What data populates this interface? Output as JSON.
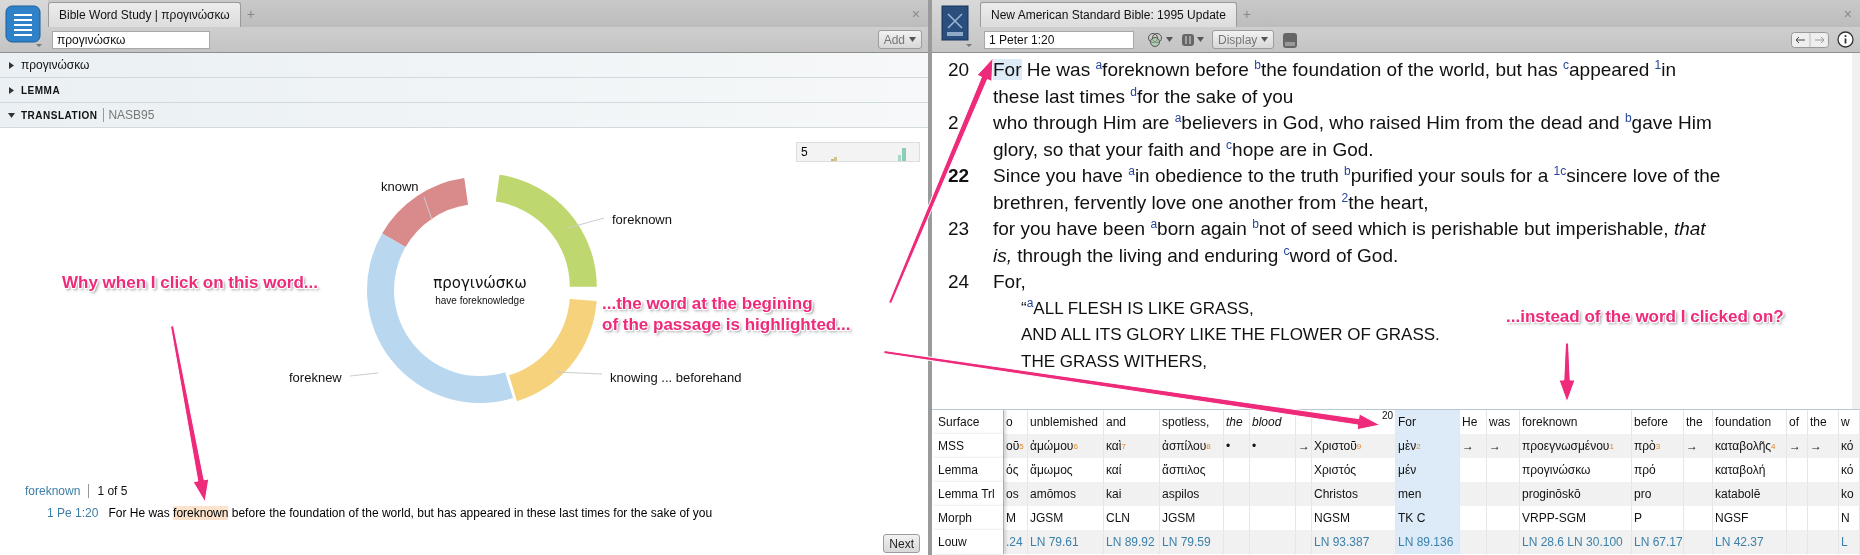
{
  "word_study": {
    "tab": {
      "title": "Bible Word Study | προγινώσκω",
      "selected": true
    },
    "new_tab": "+",
    "close": "×",
    "search": {
      "value": "προγινώσκω"
    },
    "add_button": "Add",
    "sections": [
      {
        "title": "προγινώσκω",
        "expanded": false
      },
      {
        "title": "LEMMA",
        "expanded": false
      },
      {
        "title": "TRANSLATION",
        "subtitle": "NASB95",
        "expanded": true
      }
    ],
    "mini_chart": {
      "label": "5"
    },
    "donut": {
      "center_title": "προγινώσκω",
      "center_subtitle": "have foreknowledge",
      "segments": [
        {
          "label": "known",
          "color": "#d98a8a"
        },
        {
          "label": "foreknown",
          "color": "#bed86f"
        },
        {
          "label": "foreknew",
          "color": "#b9d7ef"
        },
        {
          "label": "knowing ... beforehand",
          "color": "#f6d27c"
        }
      ]
    },
    "results": {
      "word": "foreknown",
      "count": "1 of 5",
      "items": [
        {
          "reference": "1 Pe 1:20",
          "segments": [
            {
              "text": "For He was ",
              "highlighted": false
            },
            {
              "text": "foreknown",
              "highlighted": true
            },
            {
              "text": " before the foundation of the world, but has appeared in these last times for the sake of you",
              "highlighted": false
            }
          ]
        }
      ]
    },
    "next_button": "Next"
  },
  "bible": {
    "tab": {
      "title": "New American Standard Bible: 1995 Update",
      "selected": true
    },
    "new_tab": "+",
    "close": "×",
    "reference": {
      "value": "1 Peter 1:20"
    },
    "display_button": "Display",
    "verses": [
      {
        "number": "20",
        "emphasized": false,
        "lines": [
          {
            "segments": [
              {
                "text": "For",
                "highlighted": true
              },
              {
                "text": " He was $^{a}$foreknown before $^{b}$the foundation of the world, but has $^{c}$appeared $^{1}$in",
                "highlighted": false
              }
            ]
          },
          "these last times $^{d}$for the sake of you"
        ]
      },
      {
        "number": "2",
        "emphasized": false,
        "lines": [
          "who through Him are $^{a}$believers in God, who raised Him from the dead and $^{b}$gave Him",
          "glory, so that your faith and $^{c}$hope are in God."
        ]
      },
      {
        "number": "22",
        "emphasized": true,
        "lines": [
          "Since you have $^{a}$in obedience to the truth $^{b}$purified your souls for a $^{1c}$sincere love of the",
          "brethren, fervently love one another from $^{2}$the heart,"
        ]
      },
      {
        "number": "23",
        "emphasized": false,
        "lines": [
          "for you have been $^{a}$born again $^{b}$not of seed which is perishable but imperishable, *that*",
          "*is,* through the living and enduring $^{c}$word of God."
        ]
      },
      {
        "number": "24",
        "emphasized": false,
        "lines": [
          "For,"
        ],
        "poetry": [
          "“$^{a}$ALL FLESH IS LIKE GRASS,",
          "AND ALL ITS GLORY LIKE THE FLOWER OF GRASS.",
          "THE GRASS WITHERS,"
        ]
      }
    ],
    "interlinear": {
      "row_labels": [
        "Surface",
        "MSS",
        "Lemma",
        "Lemma Trl",
        "Morph",
        "Louw"
      ],
      "columns": [
        {
          "surface": "o",
          "mss": "οῦ",
          "mss_index": "5",
          "lemma": "ός",
          "lemma_trl": "os",
          "morph": "M",
          "louw": ".24",
          "italic": false,
          "selected": false
        },
        {
          "surface": "unblemished",
          "mss": "ἀμώμου",
          "mss_index": "6",
          "lemma": "ἄμωμος",
          "lemma_trl": "amōmos",
          "morph": "JGSM",
          "louw": "LN 79.61",
          "italic": false,
          "selected": false
        },
        {
          "surface": "and",
          "mss": "καὶ",
          "mss_index": "7",
          "lemma": "καί",
          "lemma_trl": "kai",
          "morph": "CLN",
          "louw": "LN 89.92",
          "italic": false,
          "selected": false
        },
        {
          "surface": "spotless,",
          "mss": "ἀσπίλου",
          "mss_index": "8",
          "lemma": "ἄσπιλος",
          "lemma_trl": "aspilos",
          "morph": "JGSM",
          "louw": "LN 79.59",
          "italic": false,
          "selected": false
        },
        {
          "surface": "the",
          "mss": "•",
          "italic": true,
          "selected": false
        },
        {
          "surface": "blood",
          "mss": "•",
          "italic": true,
          "selected": false
        },
        {
          "mss": "→",
          "selected": false
        },
        {
          "verse_mark": "20",
          "mss": "Χριστοῦ",
          "mss_index": "9",
          "lemma": "Χριστός",
          "lemma_trl": "Christos",
          "morph": "NGSM",
          "louw": "LN 93.387",
          "selected": false
        },
        {
          "surface": "For",
          "mss": "μὲν",
          "mss_index": "2",
          "lemma": "μέν",
          "lemma_trl": "men",
          "morph": "TK C",
          "louw": "LN 89.136",
          "italic": false,
          "selected": true
        },
        {
          "surface": "He",
          "mss": "→",
          "italic": false,
          "selected": false
        },
        {
          "surface": "was",
          "mss": "→",
          "italic": false,
          "selected": false
        },
        {
          "surface": "foreknown",
          "mss": "προεγνωσμένου",
          "mss_index": "1",
          "lemma": "προγινώσκω",
          "lemma_trl": "proginōskō",
          "morph": "VRPP-SGM",
          "louw": "LN 28.6 LN 30.100",
          "italic": false,
          "selected": false
        },
        {
          "surface": "before",
          "mss": "πρὸ",
          "mss_index": "3",
          "lemma": "πρό",
          "lemma_trl": "pro",
          "morph": "P",
          "louw": "LN 67.17",
          "italic": false,
          "selected": false
        },
        {
          "surface": "the",
          "mss": "→",
          "italic": false,
          "selected": false
        },
        {
          "surface": "foundation",
          "mss": "καταβολῆς",
          "mss_index": "4",
          "lemma": "καταβολή",
          "lemma_trl": "katabolē",
          "morph": "NGSF",
          "louw": "LN 42.37",
          "italic": false,
          "selected": false
        },
        {
          "surface": "of",
          "mss": "→",
          "italic": false,
          "selected": false
        },
        {
          "surface": "the",
          "mss": "→",
          "italic": false,
          "selected": false
        },
        {
          "surface": "w",
          "mss": "κό",
          "lemma": "κό",
          "lemma_trl": "ko",
          "morph": "N",
          "louw": "L",
          "italic": false,
          "selected": false
        }
      ]
    }
  },
  "annotations": [
    {
      "lines": [
        "Why when I click on this word..."
      ]
    },
    {
      "lines": [
        "...the word at the begining",
        "of the passage is highlighted..."
      ]
    },
    {
      "lines": [
        "...instead of the word I clicked on?"
      ]
    }
  ]
}
